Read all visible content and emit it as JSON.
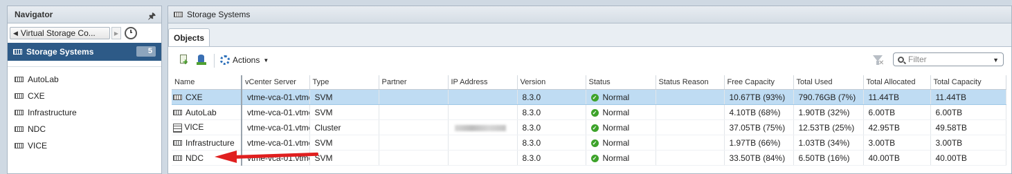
{
  "navigator": {
    "title": "Navigator",
    "breadcrumb": "Virtual Storage Co...",
    "selected": {
      "label": "Storage Systems",
      "count": "5"
    },
    "items": [
      {
        "label": "AutoLab"
      },
      {
        "label": "CXE"
      },
      {
        "label": "Infrastructure"
      },
      {
        "label": "NDC"
      },
      {
        "label": "VICE"
      }
    ]
  },
  "main": {
    "title": "Storage Systems",
    "tabs": [
      {
        "label": "Objects"
      }
    ],
    "toolbar": {
      "actions_label": "Actions",
      "filter_placeholder": "Filter"
    }
  },
  "table": {
    "columns": [
      "Name",
      "vCenter Server",
      "Type",
      "Partner",
      "IP Address",
      "Version",
      "Status",
      "Status Reason",
      "Free Capacity",
      "Total Used",
      "Total Allocated",
      "Total Capacity"
    ],
    "rows": [
      {
        "name": "CXE",
        "vcenter": "vtme-vca-01.vtme",
        "type": "SVM",
        "partner": "",
        "version": "8.3.0",
        "status": "Normal",
        "reason": "",
        "free": "10.67TB (93%)",
        "used": "790.76GB (7%)",
        "allocated": "11.44TB",
        "capacity": "11.44TB"
      },
      {
        "name": "AutoLab",
        "vcenter": "vtme-vca-01.vtme",
        "type": "SVM",
        "partner": "",
        "version": "8.3.0",
        "status": "Normal",
        "reason": "",
        "free": "4.10TB (68%)",
        "used": "1.90TB (32%)",
        "allocated": "6.00TB",
        "capacity": "6.00TB"
      },
      {
        "name": "VICE",
        "vcenter": "vtme-vca-01.vtme",
        "type": "Cluster",
        "partner": "",
        "version": "8.3.0",
        "status": "Normal",
        "reason": "",
        "free": "37.05TB (75%)",
        "used": "12.53TB (25%)",
        "allocated": "42.95TB",
        "capacity": "49.58TB"
      },
      {
        "name": "Infrastructure",
        "vcenter": "vtme-vca-01.vtme",
        "type": "SVM",
        "partner": "",
        "version": "8.3.0",
        "status": "Normal",
        "reason": "",
        "free": "1.97TB (66%)",
        "used": "1.03TB (34%)",
        "allocated": "3.00TB",
        "capacity": "3.00TB"
      },
      {
        "name": "NDC",
        "vcenter": "vtme-vca-01.vtme",
        "type": "SVM",
        "partner": "",
        "version": "8.3.0",
        "status": "Normal",
        "reason": "",
        "free": "33.50TB (84%)",
        "used": "6.50TB (16%)",
        "allocated": "40.00TB",
        "capacity": "40.00TB"
      }
    ]
  },
  "colors": {
    "selected_nav": "#2d5a87",
    "selected_row": "#bfdcf3",
    "status_ok": "#3da32a",
    "annotation": "#e01f1f"
  }
}
